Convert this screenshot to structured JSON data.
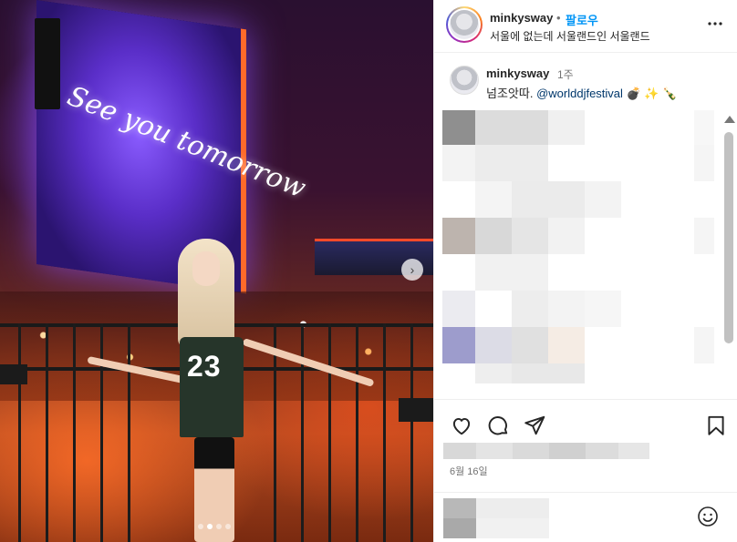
{
  "post": {
    "photo": {
      "screen_text": "See you tomorrow",
      "jersey_number": "23",
      "next_symbol": "›",
      "slide_count": 4,
      "active_slide": 2
    },
    "header": {
      "username": "minkysway",
      "separator": "•",
      "follow_label": "팔로우",
      "location": "서울에 없는데 서울랜드인 서울랜드",
      "more_icon": "more-horizontal-icon"
    },
    "caption": {
      "username": "minkysway",
      "time": "1주",
      "text": "넘조앗따.",
      "mention": "@worlddjfestival",
      "emojis": "💣 ✨ 🍾"
    },
    "actions": {
      "like_icon": "heart-icon",
      "comment_icon": "comment-icon",
      "share_icon": "send-icon",
      "save_icon": "bookmark-icon",
      "date": "6월 16일"
    },
    "composer": {
      "emoji_icon": "smiley-icon"
    }
  }
}
